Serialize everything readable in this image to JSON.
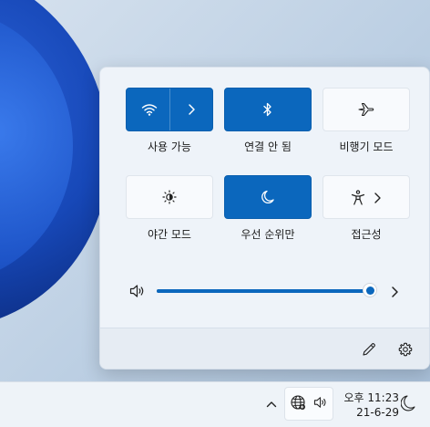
{
  "quick_settings": {
    "tiles": [
      {
        "id": "wifi",
        "label": "사용 가능",
        "icon": "wifi-icon",
        "state": "on",
        "has_chevron": true
      },
      {
        "id": "bluetooth",
        "label": "연결 안 됨",
        "icon": "bluetooth-icon",
        "state": "on",
        "has_chevron": false
      },
      {
        "id": "airplane",
        "label": "비행기 모드",
        "icon": "airplane-icon",
        "state": "off",
        "has_chevron": false
      },
      {
        "id": "night-light",
        "label": "야간 모드",
        "icon": "brightness-icon",
        "state": "off",
        "has_chevron": false
      },
      {
        "id": "focus-assist",
        "label": "우선 순위만",
        "icon": "moon-icon",
        "state": "on",
        "has_chevron": false
      },
      {
        "id": "accessibility",
        "label": "접근성",
        "icon": "accessibility-icon",
        "state": "off",
        "has_chevron": true
      }
    ],
    "volume": {
      "level_percent": 100,
      "icon": "speaker-icon"
    },
    "footer": {
      "edit_icon": "pencil-icon",
      "settings_icon": "gear-icon"
    }
  },
  "taskbar": {
    "clock": {
      "ampm_time": "오후 11:23",
      "date": "21-6-29"
    },
    "tray_icons": [
      "globe-icon",
      "speaker-icon"
    ],
    "overflow_icon": "chevron-up-icon",
    "focus_icon": "moon-icon"
  },
  "colors": {
    "accent": "#0b67bd",
    "tile_off": "#f8fafd",
    "panel_bg": "#eef3f9"
  }
}
